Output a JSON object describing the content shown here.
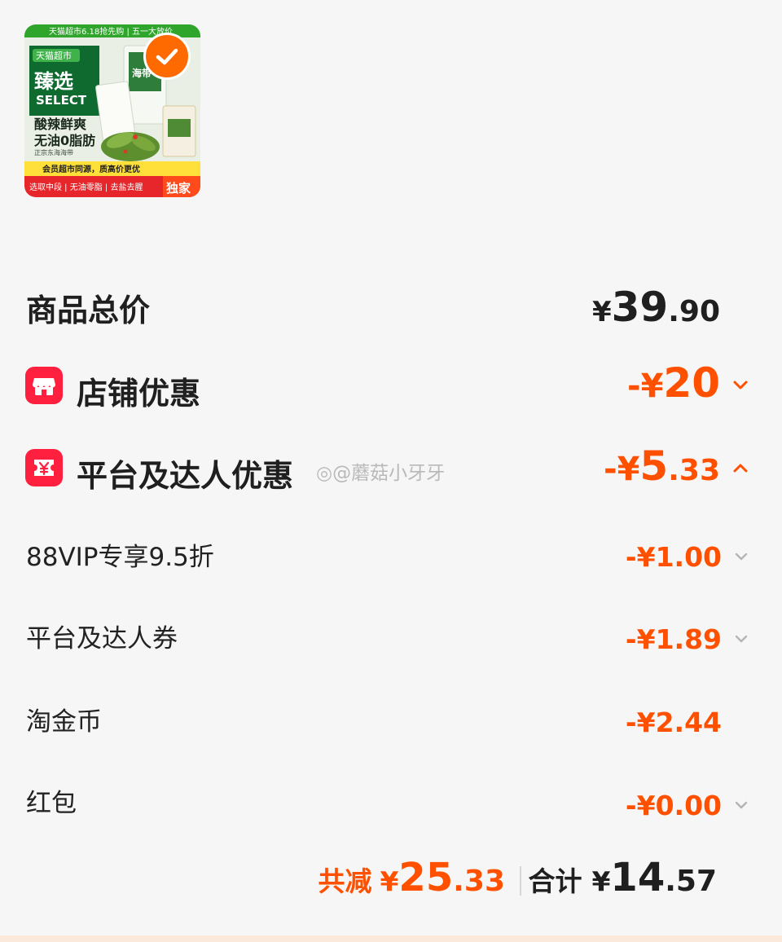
{
  "product": {
    "image": {
      "top_banner": "天猫超市6.18抢先购 | 五一大放价",
      "brand_badge": "天猫超市",
      "brand_title": "臻选",
      "brand_sub": "SELECT",
      "slogan_1": "酸辣鲜爽",
      "slogan_2": "无油0脂肪",
      "slogan_3": "正宗东海海带",
      "bottom_note": "会员超市同源，质高价更优",
      "bottom_tags": "选取中段 | 无油零脂 | 去盐去腥",
      "exclusive": "独家",
      "pack_text": "海带"
    },
    "selected": true
  },
  "summary": {
    "total": {
      "label": "商品总价",
      "currency": "¥",
      "integer": "39",
      "decimal": ".90"
    },
    "shop_discount": {
      "label": "店铺优惠",
      "prefix": "-¥",
      "integer": "20",
      "decimal": "",
      "icon": "shop-icon",
      "expand": "chevron-down-icon"
    },
    "platform_discount": {
      "label": "平台及达人优惠",
      "prefix": "-¥",
      "integer": "5",
      "decimal": ".33",
      "icon": "coupon-yen-icon",
      "expand": "chevron-up-icon"
    },
    "details": [
      {
        "label": "88VIP专享9.5折",
        "amount": "-¥1.00",
        "expandable": true
      },
      {
        "label": "平台及达人券",
        "amount": "-¥1.89",
        "expandable": true
      },
      {
        "label": "淘金币",
        "amount": "-¥2.44",
        "expandable": false
      },
      {
        "label": "红包",
        "amount": "-¥0.00",
        "expandable": true
      }
    ],
    "footer": {
      "saved_label": "共减",
      "saved_currency": "¥",
      "saved_integer": "25",
      "saved_decimal": ".33",
      "total_label": "合计",
      "total_currency": "¥",
      "total_integer": "14",
      "total_decimal": ".57"
    }
  },
  "watermark": "@蘑菇小牙牙",
  "colors": {
    "accent": "#ff5000",
    "icon_red": "#ff1f3f",
    "text_dark": "#1f1f1f",
    "chevron": "#b5b5b5",
    "background": "#f6f6f6"
  }
}
